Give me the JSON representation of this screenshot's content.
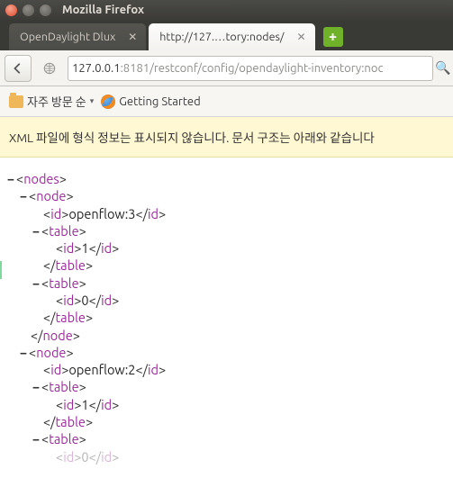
{
  "window": {
    "title": "Mozilla Firefox"
  },
  "tabs": [
    {
      "label": "OpenDaylight Dlux",
      "active": false
    },
    {
      "label": "http://127.…tory:nodes/",
      "active": true
    }
  ],
  "url": {
    "host": "127.0.0.1",
    "path": ":8181/restconf/config/opendaylight-inventory:noc"
  },
  "bookmarks": {
    "recent_label": "자주 방문 순",
    "getting_started_label": "Getting Started"
  },
  "infobar": {
    "text": "XML 파일에 형식 정보는 표시되지 않습니다. 문서 구조는 아래와 같습니다"
  },
  "xml": {
    "root": "nodes",
    "nodes": [
      {
        "id_tag": "id",
        "id_val": "openflow:3",
        "tables": [
          {
            "tag": "table",
            "id_tag": "id",
            "id_val": "1"
          },
          {
            "tag": "table",
            "id_tag": "id",
            "id_val": "0"
          }
        ]
      },
      {
        "id_tag": "id",
        "id_val": "openflow:2",
        "tables": [
          {
            "tag": "table",
            "id_tag": "id",
            "id_val": "1"
          },
          {
            "tag": "table",
            "id_tag": "id",
            "id_val": "0"
          }
        ]
      }
    ],
    "node_tag": "node"
  }
}
